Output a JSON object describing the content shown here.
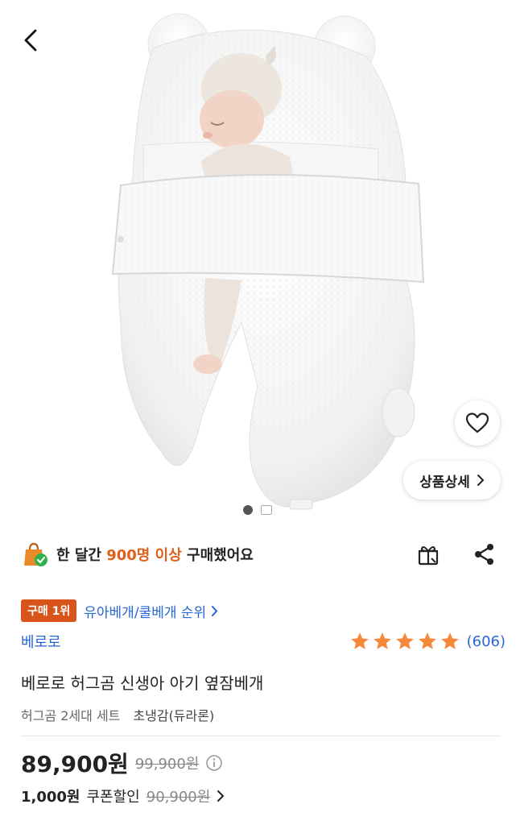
{
  "hero": {
    "detail_button_label": "상품상세",
    "icons": [
      "back-arrow-icon",
      "heart-icon",
      "chevron-right-icon"
    ]
  },
  "purchase_stats": {
    "prefix": "한 달간",
    "highlight": "900명 이상",
    "suffix": "구매했어요",
    "accent_color": "#e0601b"
  },
  "ranking": {
    "badge": "구매 1위",
    "link": "유아베개/쿨베개 순위"
  },
  "brand": "베로로",
  "rating": {
    "stars": 5,
    "count": "(606)",
    "star_color": "#f5883a"
  },
  "product": {
    "title": "베로로 허그곰 신생아 아기 옆잠베개",
    "option_name": "허그곰 2세대 세트",
    "option_value": "초냉감(듀라론)"
  },
  "price": {
    "sale": "89,900원",
    "original": "99,900원",
    "coupon_price": "1,000원",
    "coupon_label": "쿠폰할인",
    "coupon_original": "90,900원"
  },
  "colors": {
    "link": "#2766d6",
    "badge": "#d8541a"
  }
}
